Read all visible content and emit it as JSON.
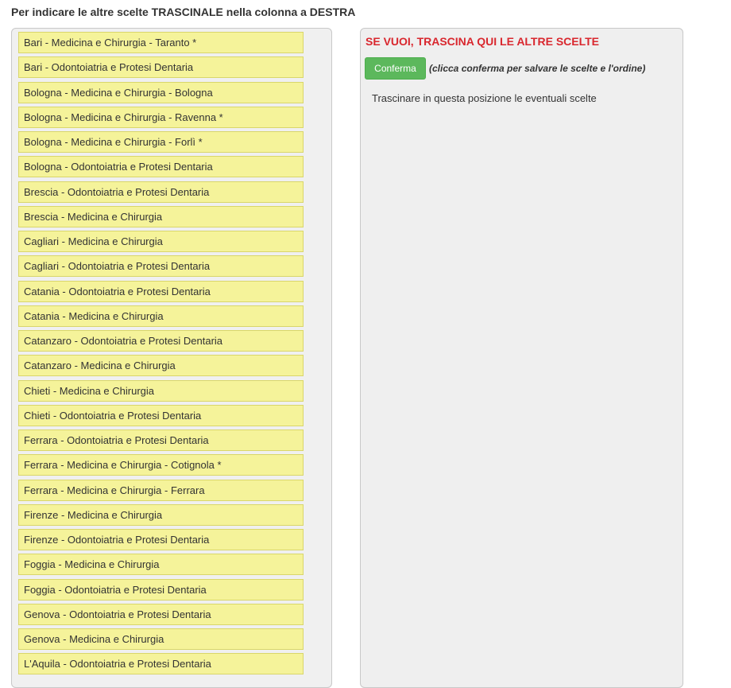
{
  "instruction": "Per indicare le altre scelte TRASCINALE nella colonna a DESTRA",
  "left_column": {
    "items": [
      "Bari - Medicina e Chirurgia - Taranto *",
      "Bari - Odontoiatria e Protesi Dentaria",
      "Bologna - Medicina e Chirurgia - Bologna",
      "Bologna - Medicina e Chirurgia - Ravenna *",
      "Bologna - Medicina e Chirurgia - Forlì *",
      "Bologna - Odontoiatria e Protesi Dentaria",
      "Brescia - Odontoiatria e Protesi Dentaria",
      "Brescia - Medicina e Chirurgia",
      "Cagliari - Medicina e Chirurgia",
      "Cagliari - Odontoiatria e Protesi Dentaria",
      "Catania - Odontoiatria e Protesi Dentaria",
      "Catania - Medicina e Chirurgia",
      "Catanzaro - Odontoiatria e Protesi Dentaria",
      "Catanzaro - Medicina e Chirurgia",
      "Chieti - Medicina e Chirurgia",
      "Chieti - Odontoiatria e Protesi Dentaria",
      "Ferrara - Odontoiatria e Protesi Dentaria",
      "Ferrara - Medicina e Chirurgia - Cotignola *",
      "Ferrara - Medicina e Chirurgia - Ferrara",
      "Firenze - Medicina e Chirurgia",
      "Firenze - Odontoiatria e Protesi Dentaria",
      "Foggia - Medicina e Chirurgia",
      "Foggia - Odontoiatria e Protesi Dentaria",
      "Genova - Odontoiatria e Protesi Dentaria",
      "Genova - Medicina e Chirurgia",
      "L'Aquila - Odontoiatria e Protesi Dentaria"
    ]
  },
  "right_column": {
    "title": "SE VUOI, TRASCINA QUI LE ALTRE SCELTE",
    "confirm_label": "Conferma",
    "confirm_hint": "(clicca conferma per salvare le scelte e l'ordine)",
    "drop_placeholder": "Trascinare in questa posizione le eventuali scelte"
  },
  "colors": {
    "item_background": "#f5f39a",
    "item_border": "#d9d66a",
    "title_red": "#d9272e",
    "confirm_green": "#5cb85c",
    "panel_background": "#f0f0f0"
  }
}
